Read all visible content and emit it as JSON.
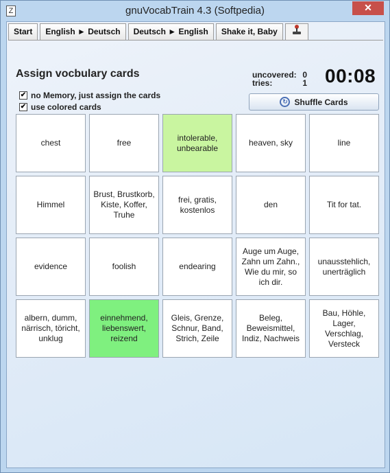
{
  "window": {
    "title": "gnuVocabTrain 4.3 (Softpedia)",
    "close_glyph": "✕"
  },
  "tabs": [
    {
      "label": "Start"
    },
    {
      "label": "English ► Deutsch"
    },
    {
      "label": "Deutsch ► English"
    },
    {
      "label": "Shake it, Baby"
    },
    {
      "label": "",
      "icon": "joystick-icon"
    }
  ],
  "panel": {
    "heading": "Assign vocbulary cards",
    "stats": {
      "uncovered_label": "uncovered:",
      "uncovered_value": "0",
      "tries_label": "tries:",
      "tries_value": "1"
    },
    "timer": "00:08",
    "options": {
      "no_memory_label": "no Memory, just assign the cards",
      "no_memory_checked": true,
      "colored_label": "use colored cards",
      "colored_checked": true
    },
    "shuffle_label": "Shuffle Cards"
  },
  "cards": [
    {
      "text": "chest",
      "highlight": "none"
    },
    {
      "text": "free",
      "highlight": "none"
    },
    {
      "text": "intolerable, unbearable",
      "highlight": "yellow"
    },
    {
      "text": "heaven, sky",
      "highlight": "none"
    },
    {
      "text": "line",
      "highlight": "none"
    },
    {
      "text": "Himmel",
      "highlight": "none"
    },
    {
      "text": "Brust, Brustkorb, Kiste, Koffer, Truhe",
      "highlight": "none"
    },
    {
      "text": "frei, gratis, kostenlos",
      "highlight": "none"
    },
    {
      "text": "den",
      "highlight": "none"
    },
    {
      "text": "Tit for tat.",
      "highlight": "none"
    },
    {
      "text": "evidence",
      "highlight": "none"
    },
    {
      "text": "foolish",
      "highlight": "none"
    },
    {
      "text": "endearing",
      "highlight": "none"
    },
    {
      "text": "Auge um Auge, Zahn um Zahn., Wie du mir, so ich dir.",
      "highlight": "none"
    },
    {
      "text": "unausstehlich, unerträglich",
      "highlight": "none"
    },
    {
      "text": "albern, dumm, närrisch, töricht, unklug",
      "highlight": "none"
    },
    {
      "text": "einnehmend, liebenswert, reizend",
      "highlight": "green"
    },
    {
      "text": "Gleis, Grenze, Schnur, Band, Strich, Zeile",
      "highlight": "none"
    },
    {
      "text": "Beleg, Beweismittel, Indiz, Nachweis",
      "highlight": "none"
    },
    {
      "text": "Bau, Höhle, Lager, Verschlag, Versteck",
      "highlight": "none"
    }
  ],
  "colors": {
    "yellow": "#c9f5a0",
    "green": "#7ff07f"
  }
}
